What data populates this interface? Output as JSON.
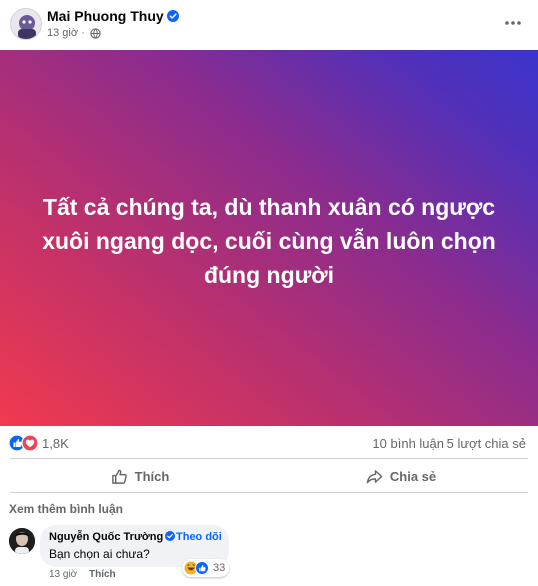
{
  "post": {
    "author_name": "Mai Phuong Thuy",
    "time": "13 giờ",
    "audience_icon": "globe-icon",
    "text": "Tất cả chúng ta, dù thanh xuân có ngược xuôi ngang dọc, cuối cùng vẫn luôn chọn đúng người",
    "background_gradient": [
      "#f13a4e",
      "#8a2c8f",
      "#3b35cc"
    ]
  },
  "reactions": {
    "icons": [
      "like-icon",
      "love-icon"
    ],
    "count": "1,8K",
    "comments": "10 bình luận",
    "shares": "5 lượt chia sẻ"
  },
  "actions": {
    "like_label": "Thích",
    "share_label": "Chia sẻ"
  },
  "comments_section": {
    "more_label": "Xem thêm bình luận",
    "comment": {
      "author": "Nguyễn Quốc Trường",
      "follow_label": "Theo dõi",
      "text": "Bạn chọn ai chưa?",
      "time": "13 giờ",
      "like_label": "Thích",
      "reaction_icons": [
        "haha-icon",
        "like-icon"
      ],
      "reaction_count": "33"
    }
  },
  "colors": {
    "accent": "#0866ff",
    "secondary_text": "#65676b",
    "verified": "#0866ff"
  }
}
